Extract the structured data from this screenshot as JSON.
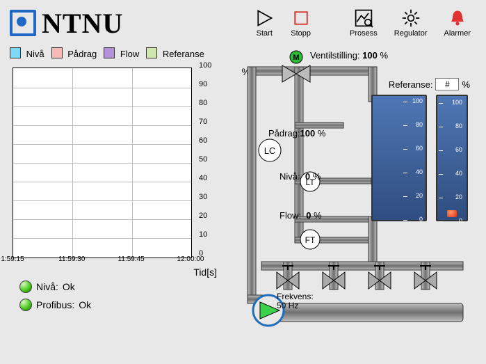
{
  "logo_text": "NTNU",
  "toolbar": {
    "start": "Start",
    "stopp": "Stopp",
    "prosess": "Prosess",
    "regulator": "Regulator",
    "alarmer": "Alarmer"
  },
  "legend": {
    "niva": {
      "label": "Nivå",
      "color": "#7ed8f8"
    },
    "padrag": {
      "label": "Pådrag",
      "color": "#f8b8b8"
    },
    "flow": {
      "label": "Flow",
      "color": "#b491d8"
    },
    "referanse": {
      "label": "Referanse",
      "color": "#cfe8b0"
    }
  },
  "chart_data": {
    "type": "line",
    "x_ticks": [
      "1:59:15",
      "11:59:30",
      "11:59:45",
      "12:00:00"
    ],
    "y_ticks": [
      100,
      90,
      80,
      70,
      60,
      50,
      40,
      30,
      20,
      10,
      0
    ],
    "ylim": [
      0,
      100
    ],
    "y_unit": "%",
    "xlabel": "Tid[s]",
    "series": [
      {
        "name": "Nivå",
        "color": "#7ed8f8",
        "values": []
      },
      {
        "name": "Pådrag",
        "color": "#f8b8b8",
        "values": []
      },
      {
        "name": "Flow",
        "color": "#b491d8",
        "values": []
      },
      {
        "name": "Referanse",
        "color": "#cfe8b0",
        "values": []
      }
    ]
  },
  "status": {
    "niva": {
      "label": "Nivå:",
      "value": "Ok"
    },
    "profibus": {
      "label": "Profibus:",
      "value": "Ok"
    }
  },
  "process": {
    "ventilstilling": {
      "label": "Ventilstilling:",
      "value": "100",
      "unit": "%"
    },
    "referanse": {
      "label": "Referanse:",
      "value": "#",
      "unit": "%"
    },
    "padrag": {
      "label": "Pådrag:",
      "value": "100",
      "unit": "%"
    },
    "niva": {
      "label": "Nivå:",
      "value": "0",
      "unit": "%"
    },
    "flow": {
      "label": "Flow:",
      "value": "0",
      "unit": "%"
    },
    "frekvens": {
      "label": "Frekvens:",
      "value": "50",
      "unit": "Hz"
    },
    "lc": "LC",
    "lt": "LT",
    "ft": "FT",
    "motor": "M"
  },
  "gauge_ticks": [
    100,
    80,
    60,
    40,
    20,
    0
  ]
}
